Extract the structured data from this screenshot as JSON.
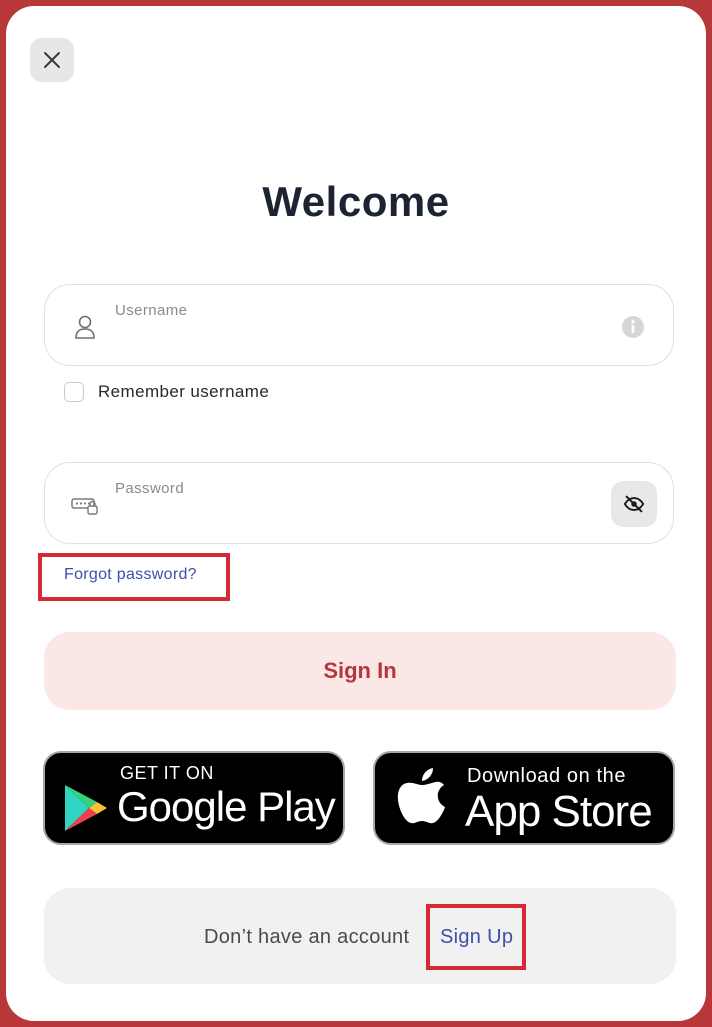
{
  "title": "Welcome",
  "username": {
    "label": "Username"
  },
  "remember": {
    "label": "Remember username"
  },
  "password": {
    "label": "Password"
  },
  "forgot": {
    "label": "Forgot password?"
  },
  "signin": {
    "label": "Sign In"
  },
  "stores": {
    "google": {
      "small": "GET IT ON",
      "big": "Google Play"
    },
    "apple": {
      "small": "Download on the",
      "big": "App Store"
    }
  },
  "signup": {
    "prompt": "Don’t have an account",
    "link": "Sign Up"
  },
  "icons": {
    "close": "close-icon",
    "user": "user-icon",
    "info": "info-icon",
    "password": "password-keypad-icon",
    "eye": "eye-slash-icon"
  },
  "colors": {
    "accent": "#b5373c",
    "link": "#3f4ea8",
    "highlight": "#d42a35",
    "signin_bg": "#fbe7e6"
  }
}
